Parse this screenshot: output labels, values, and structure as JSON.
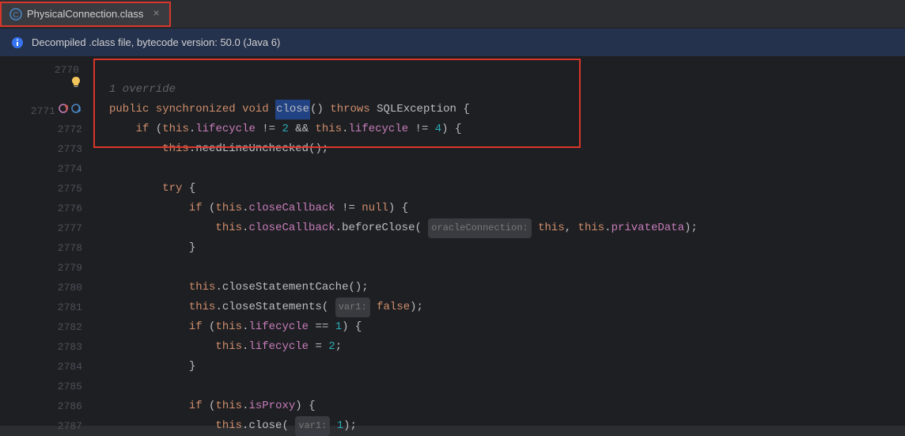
{
  "tab": {
    "filename": "PhysicalConnection.class",
    "close_glyph": "×"
  },
  "banner": {
    "text": "Decompiled .class file, bytecode version: 50.0 (Java 6)"
  },
  "gutter": {
    "lines": [
      "2770",
      "2771",
      "2772",
      "2773",
      "2774",
      "2775",
      "2776",
      "2777",
      "2778",
      "2779",
      "2780",
      "2781",
      "2782",
      "2783",
      "2784",
      "2785",
      "2786",
      "2787"
    ]
  },
  "code": {
    "override_hint": "1 override",
    "kw_public": "public",
    "kw_sync": "synchronized",
    "kw_void": "void",
    "method_close": "close",
    "parens": "()",
    "kw_throws": "throws",
    "sqlexc": "SQLException",
    "brace_open": " {",
    "kw_if": "if",
    "kw_this": "this",
    "field_lifecycle": "lifecycle",
    "neq": " != ",
    "num2": "2",
    "andand": " && ",
    "num4": "4",
    "paren_close_brace": ") {",
    "method_needLine": "needLineUnchecked",
    "call_suffix": "();",
    "kw_try": "try",
    "field_closeCallback": "closeCallback",
    "kw_null": "null",
    "method_beforeClose": "beforeClose",
    "hint_oracleConn": "oracleConnection:",
    "comma_sp": ", ",
    "field_privateData": "privateData",
    "call_end_paren": ");",
    "brace_close": "}",
    "method_closeStmtCache": "closeStatementCache",
    "method_closeStmts": "closeStatements",
    "hint_var1": "var1:",
    "kw_false": "false",
    "eqeq": " == ",
    "num1": "1",
    "assign_eq": " = ",
    "semi": ";",
    "field_isProxy": "isProxy",
    "method_close2": "close",
    "hint_var1b": "var1:",
    "num1b": "1"
  }
}
